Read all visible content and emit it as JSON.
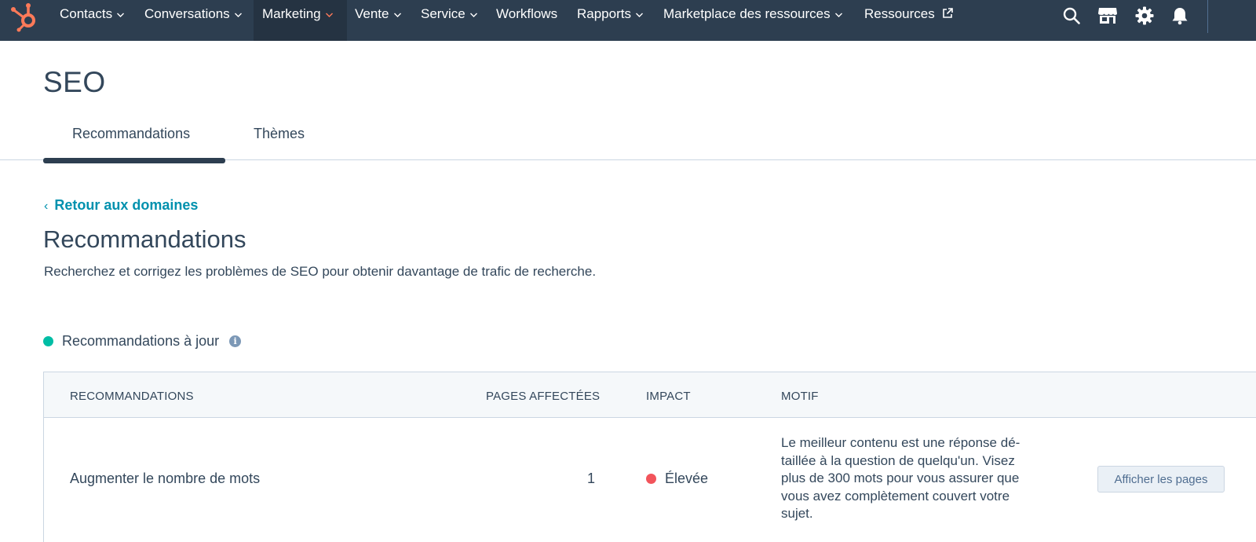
{
  "nav": {
    "logo": "hubspot-sprocket-logo",
    "items": [
      {
        "label": "Contacts",
        "dropdown": true
      },
      {
        "label": "Conversations",
        "dropdown": true
      },
      {
        "label": "Marketing",
        "dropdown": true,
        "active": true
      },
      {
        "label": "Vente",
        "dropdown": true
      },
      {
        "label": "Service",
        "dropdown": true
      },
      {
        "label": "Workflows",
        "dropdown": false
      },
      {
        "label": "Rapports",
        "dropdown": true
      },
      {
        "label": "Marketplace des ressources",
        "dropdown": true
      },
      {
        "label": "Ressources",
        "dropdown": false,
        "external": true
      }
    ],
    "icons": [
      "search-icon",
      "marketplace-icon",
      "settings-gear-icon",
      "notifications-bell-icon"
    ]
  },
  "page": {
    "title": "SEO",
    "tabs": [
      {
        "label": "Recommandations",
        "active": true
      },
      {
        "label": "Thèmes",
        "active": false
      }
    ],
    "back_link": "Retour aux domaines",
    "section_title": "Recommandations",
    "section_description": "Recherchez et corrigez les problèmes de SEO pour obtenir davantage de trafic de recherche.",
    "status": "Recommandations à jour"
  },
  "table": {
    "headers": [
      "RECOMMANDATIONS",
      "PAGES AFFECTÉES",
      "IMPACT",
      "MOTIF"
    ],
    "rows": [
      {
        "recommendation": "Augmenter le nombre de mots",
        "pages_affected": "1",
        "impact": "Élevée",
        "reason_lines": [
          "Le meilleur contenu est une réponse dé-",
          "taillée à la question de quelqu'un. Visez",
          "plus de 300 mots pour vous assurer que",
          "vous avez complètement couvert votre",
          "sujet."
        ],
        "action": "Afficher les pages"
      }
    ]
  },
  "colors": {
    "nav_bg": "#2d3e50",
    "accent_orange": "#ff7a59",
    "link": "#0091ae",
    "status_green": "#00bda5",
    "impact_high": "#f2545b"
  }
}
